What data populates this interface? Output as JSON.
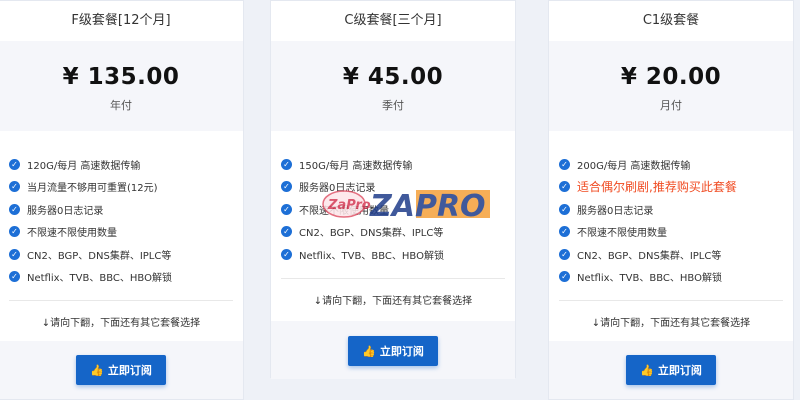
{
  "plans": [
    {
      "title": "F级套餐[12个月]",
      "price": "¥ 135.00",
      "period": "年付",
      "features": [
        {
          "text": "120G/每月 高速数据传输",
          "highlight": false
        },
        {
          "text": "当月流量不够用可重置(12元)",
          "highlight": false
        },
        {
          "text": "服务器0日志记录",
          "highlight": false
        },
        {
          "text": "不限速不限使用数量",
          "highlight": false
        },
        {
          "text": "CN2、BGP、DNS集群、IPLC等",
          "highlight": false
        },
        {
          "text": "Netflix、TVB、BBC、HBO解锁",
          "highlight": false
        }
      ],
      "note": "↓请向下翻，下面还有其它套餐选择",
      "button": "立即订阅"
    },
    {
      "title": "C级套餐[三个月]",
      "price": "¥ 45.00",
      "period": "季付",
      "features": [
        {
          "text": "150G/每月 高速数据传输",
          "highlight": false
        },
        {
          "text": "服务器0日志记录",
          "highlight": false
        },
        {
          "text": "不限速不限使用数量",
          "highlight": false
        },
        {
          "text": "CN2、BGP、DNS集群、IPLC等",
          "highlight": false
        },
        {
          "text": "Netflix、TVB、BBC、HBO解锁",
          "highlight": false
        }
      ],
      "note": "↓请向下翻，下面还有其它套餐选择",
      "button": "立即订阅"
    },
    {
      "title": "C1级套餐",
      "price": "¥ 20.00",
      "period": "月付",
      "features": [
        {
          "text": "200G/每月 高速数据传输",
          "highlight": false
        },
        {
          "text": "适合偶尔刷剧,推荐购买此套餐",
          "highlight": true
        },
        {
          "text": "服务器0日志记录",
          "highlight": false
        },
        {
          "text": "不限速不限使用数量",
          "highlight": false
        },
        {
          "text": "CN2、BGP、DNS集群、IPLC等",
          "highlight": false
        },
        {
          "text": "Netflix、TVB、BBC、HBO解锁",
          "highlight": false
        }
      ],
      "note": "↓请向下翻，下面还有其它套餐选择",
      "button": "立即订阅"
    }
  ],
  "watermark": {
    "small": "ZaPro",
    "large": "ZAPRO"
  },
  "colors": {
    "accent": "#1565c8",
    "highlight": "#f04b22",
    "check": "#1d6fd6"
  },
  "icons": {
    "check": "check-circle-icon",
    "button": "thumbs-up-icon"
  }
}
